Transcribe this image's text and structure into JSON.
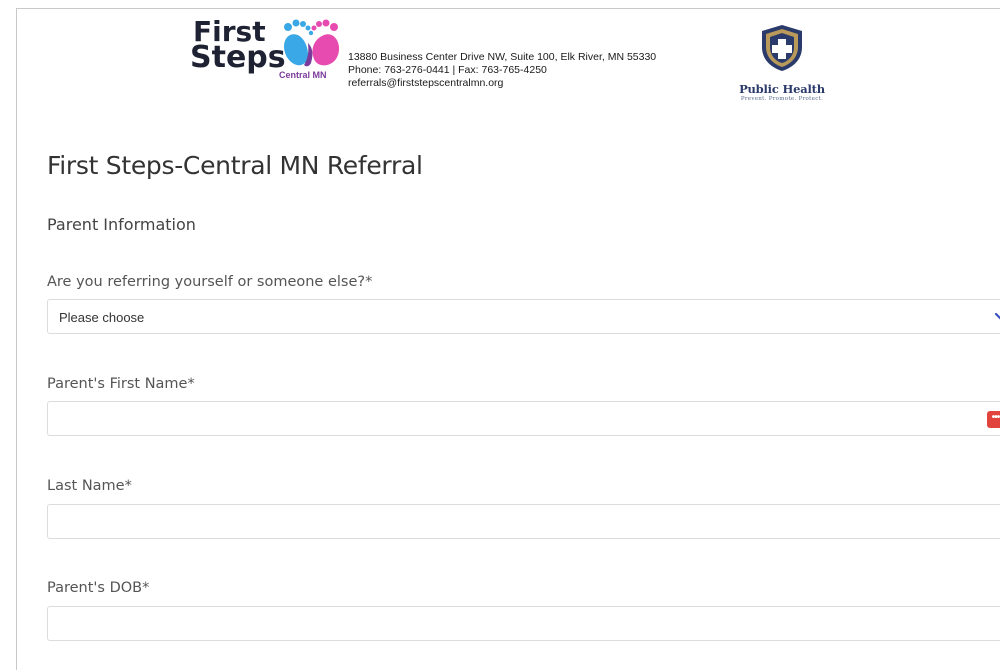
{
  "header": {
    "logo": {
      "line1": "First",
      "line2": "Steps",
      "sub": "Central MN"
    },
    "contact": {
      "address": "13880 Business Center Drive NW, Suite 100, Elk River, MN 55330",
      "phone_fax": "Phone: 763-276-0441 | Fax: 763-765-4250",
      "email": "referrals@firststepscentralmn.org"
    },
    "partner_logo": {
      "name": "Public Health",
      "tagline": "Prevent. Promote. Protect."
    }
  },
  "form": {
    "title": "First Steps-Central MN Referral",
    "section": "Parent Information",
    "referral_type": {
      "label": "Are you referring yourself or someone else?*",
      "value": "Please choose"
    },
    "first_name": {
      "label": "Parent's First Name*",
      "value": ""
    },
    "last_name": {
      "label": "Last Name*",
      "value": ""
    },
    "dob": {
      "label": "Parent's DOB*",
      "value": ""
    }
  },
  "colors": {
    "accent_chevron": "#3b4fc4",
    "password_manager_icon": "#e0443c",
    "field_border": "#dcdcdc"
  },
  "icons": {
    "dropdown": "chevron-down-icon",
    "password_manager": "password-manager-icon",
    "logo_feet": "baby-feet-icon",
    "partner_shield": "shield-cross-icon"
  }
}
